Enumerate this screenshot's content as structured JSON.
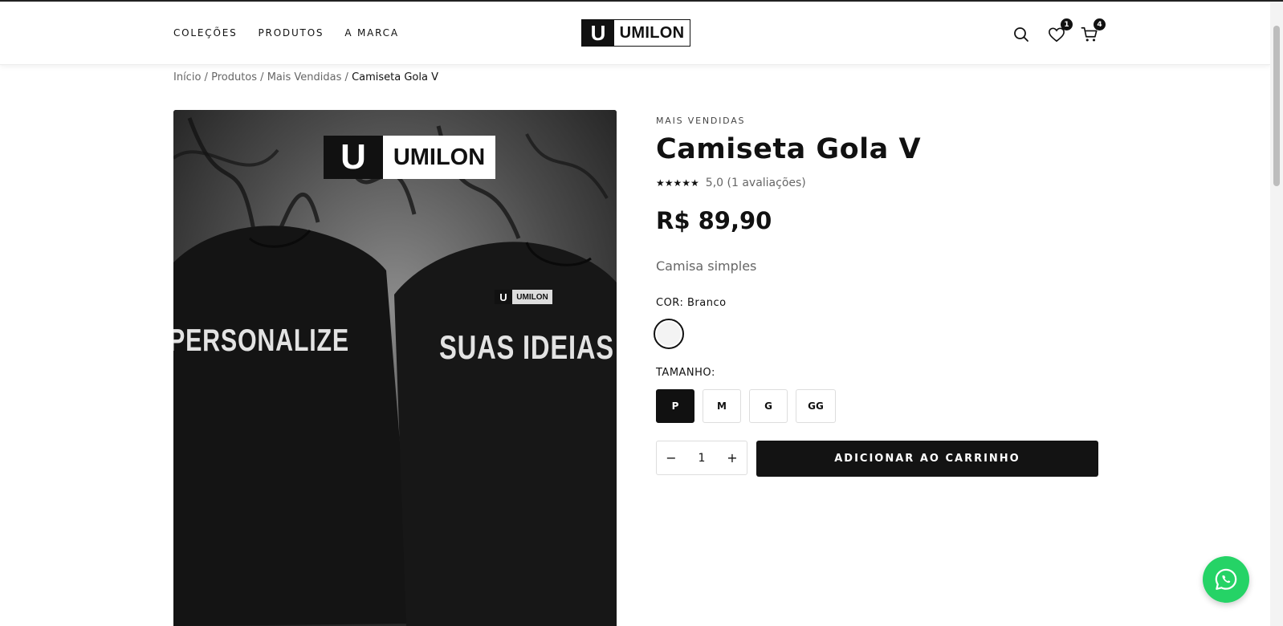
{
  "nav": {
    "items": [
      {
        "label": "COLEÇÕES"
      },
      {
        "label": "PRODUTOS"
      },
      {
        "label": "A MARCA"
      }
    ]
  },
  "logo": {
    "mark": "U",
    "text": "UMILON"
  },
  "header_icons": {
    "search": "search-icon",
    "wishlist": {
      "icon": "heart-icon",
      "count": "1"
    },
    "cart": {
      "icon": "cart-icon",
      "count": "4"
    }
  },
  "breadcrumb": {
    "items": [
      "Início",
      "Produtos",
      "Mais Vendidas"
    ],
    "separator": "/",
    "current": "Camiseta Gola V"
  },
  "product_image": {
    "logo_mark": "U",
    "logo_text": "UMILON",
    "mini_logo_text": "UMILON",
    "text_left": "PERSONALIZE",
    "text_right": "SUAS IDEIAS"
  },
  "product": {
    "category": "MAIS VENDIDAS",
    "title": "Camiseta Gola V",
    "stars": "★★★★★",
    "rating_text": "5,0 (1 avaliações)",
    "price": "R$ 89,90",
    "description": "Camisa simples",
    "color_label": "COR:",
    "color_value": "Branco",
    "color_hex": "#f3f3f3",
    "size_label": "TAMANHO:",
    "sizes": [
      "P",
      "M",
      "G",
      "GG"
    ],
    "selected_size": "P",
    "quantity": "1",
    "qty_minus": "−",
    "qty_plus": "+",
    "add_to_cart": "ADICIONAR AO CARRINHO"
  },
  "colors": {
    "accent": "#131313",
    "whatsapp": "#25d366"
  }
}
